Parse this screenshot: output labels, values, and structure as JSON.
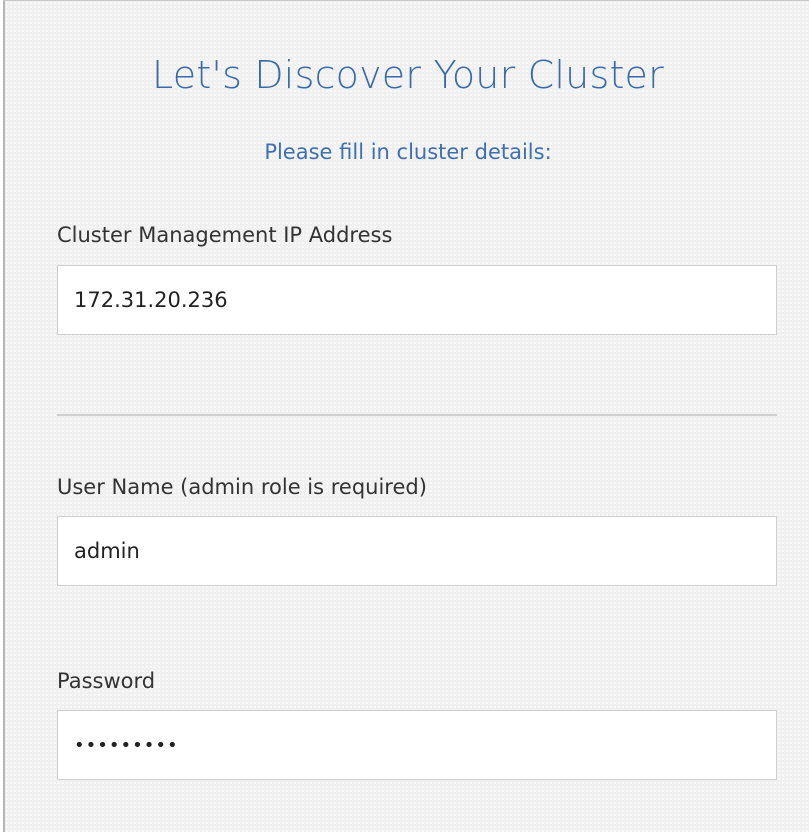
{
  "form": {
    "title": "Let's Discover Your Cluster",
    "subtitle": "Please fill in cluster details:",
    "ip_address": {
      "label": "Cluster Management IP Address",
      "value": "172.31.20.236"
    },
    "username": {
      "label": "User Name (admin role is required)",
      "value": "admin"
    },
    "password": {
      "label": "Password",
      "value": "•••••••••"
    }
  },
  "colors": {
    "accent": "#3a6aa8",
    "background": "#f0f0f0",
    "field_border": "#cfcfcf"
  }
}
